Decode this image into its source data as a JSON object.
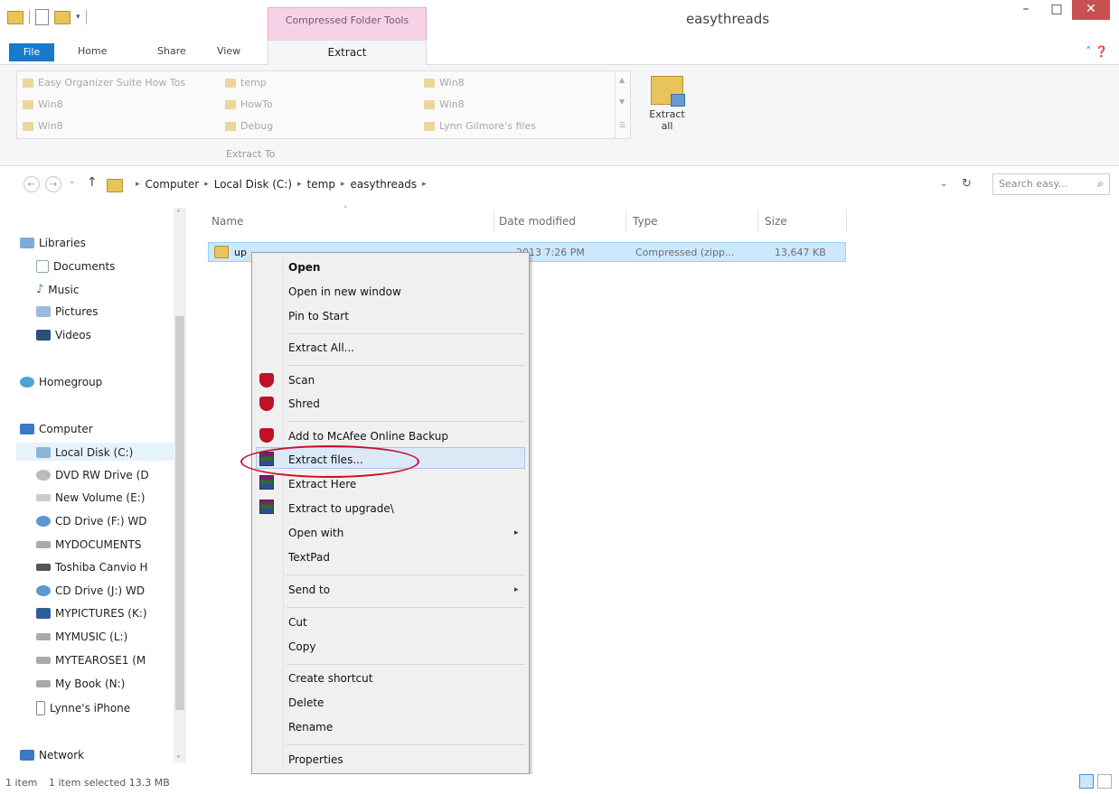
{
  "window": {
    "title": "easythreads",
    "minimize": "–",
    "maximize": "□",
    "close": "✕"
  },
  "ribbon": {
    "context_tab_label": "Compressed Folder Tools",
    "tabs": {
      "file": "File",
      "home": "Home",
      "share": "Share",
      "view": "View",
      "extract": "Extract"
    },
    "destinations": [
      "Easy Organizer Suite How Tos",
      "temp",
      "Win8",
      "Win8",
      "HowTo",
      "Win8",
      "Win8",
      "Debug",
      "Lynn Gilmore's files"
    ],
    "extract_to_label": "Extract To",
    "extract_all_label_1": "Extract",
    "extract_all_label_2": "all"
  },
  "address": {
    "back": "←",
    "forward": "→",
    "recent": "⌄",
    "up": "↑",
    "crumbs": [
      "Computer",
      "Local Disk (C:)",
      "temp",
      "easythreads"
    ],
    "dropdown": "⌄",
    "refresh": "↻",
    "search_placeholder": "Search easy...",
    "search_icon": "⌕"
  },
  "nav": {
    "libraries": "Libraries",
    "documents": "Documents",
    "music": "Music",
    "pictures": "Pictures",
    "videos": "Videos",
    "homegroup": "Homegroup",
    "computer": "Computer",
    "drives": [
      "Local Disk (C:)",
      "DVD RW Drive (D",
      "New Volume (E:)",
      "CD Drive (F:) WD",
      "MYDOCUMENTS",
      "Toshiba Canvio H",
      "CD Drive (J:) WD",
      "MYPICTURES (K:)",
      "MYMUSIC (L:)",
      "MYTEAROSE1 (M",
      "My Book (N:)",
      "Lynne's iPhone"
    ],
    "network": "Network",
    "scroll_up": "˄",
    "scroll_down": "˅"
  },
  "columns": {
    "name": "Name",
    "date": "Date modified",
    "type": "Type",
    "size": "Size",
    "sort_arrow": "˄"
  },
  "file": {
    "name": "up",
    "date": "2013 7:26 PM",
    "type": "Compressed (zipp...",
    "size": "13,647 KB"
  },
  "context_menu": {
    "open": "Open",
    "open_new": "Open in new window",
    "pin": "Pin to Start",
    "extract_all": "Extract All...",
    "scan": "Scan",
    "shred": "Shred",
    "mcafee_backup": "Add to McAfee Online Backup",
    "extract_files": "Extract files...",
    "extract_here": "Extract Here",
    "extract_to": "Extract to upgrade\\",
    "open_with": "Open with",
    "textpad": "TextPad",
    "send_to": "Send to",
    "cut": "Cut",
    "copy": "Copy",
    "create_shortcut": "Create shortcut",
    "delete": "Delete",
    "rename": "Rename",
    "properties": "Properties",
    "submenu_arrow": "▸"
  },
  "status": {
    "count": "1 item",
    "selected": "1 item selected  13.3 MB"
  },
  "colors": {
    "accent": "#1979ca",
    "context_tab": "#f6d2e6",
    "selection": "#cce8ff",
    "annotation": "#c8102e"
  }
}
